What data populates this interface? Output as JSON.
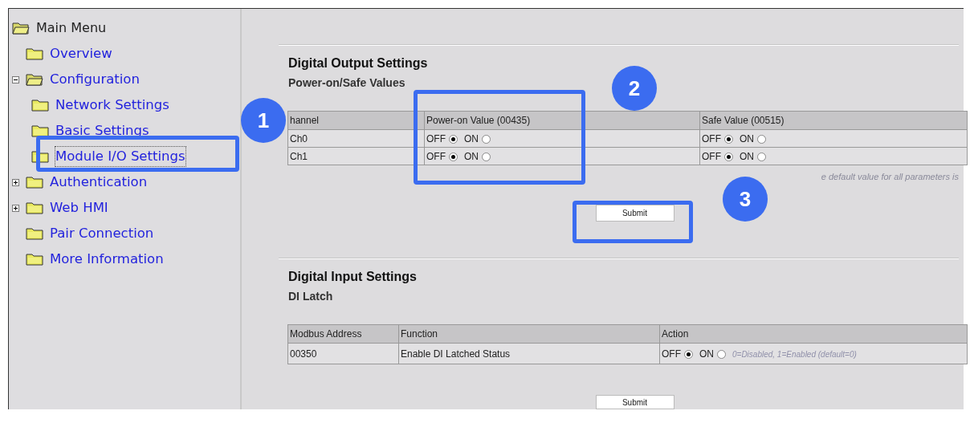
{
  "sidebar": {
    "root": {
      "label": "Main Menu",
      "expanded": true
    },
    "items": [
      {
        "label": "Overview",
        "selected": false
      },
      {
        "label": "Configuration",
        "selected": false,
        "expanded": true,
        "children": [
          {
            "label": "Network Settings",
            "selected": false
          },
          {
            "label": "Basic Settings",
            "selected": false
          },
          {
            "label": "Module I/O Settings",
            "selected": true
          }
        ]
      },
      {
        "label": "Authentication",
        "selected": false,
        "expanded": false
      },
      {
        "label": "Web HMI",
        "selected": false,
        "expanded": false
      },
      {
        "label": "Pair Connection",
        "selected": false
      },
      {
        "label": "More Information",
        "selected": false
      }
    ]
  },
  "output_section": {
    "title": "Digital Output Settings",
    "subtitle": "Power-on/Safe Values",
    "columns": [
      "hannel",
      "Power-on Value (00435)",
      "Safe Value (00515)"
    ],
    "rows": [
      {
        "channel": "Ch0",
        "power_on": [
          {
            "label": "OFF",
            "selected": true
          },
          {
            "label": "ON",
            "selected": false
          }
        ],
        "safe": [
          {
            "label": "OFF",
            "selected": true
          },
          {
            "label": "ON",
            "selected": false
          }
        ]
      },
      {
        "channel": "Ch1",
        "power_on": [
          {
            "label": "OFF",
            "selected": true
          },
          {
            "label": "ON",
            "selected": false
          }
        ],
        "safe": [
          {
            "label": "OFF",
            "selected": true
          },
          {
            "label": "ON",
            "selected": false
          }
        ]
      }
    ],
    "note": "e default value for all parameters is",
    "submit": "Submit"
  },
  "input_section": {
    "title": "Digital Input Settings",
    "subtitle": "DI Latch",
    "columns": [
      "Modbus Address",
      "Function",
      "Action"
    ],
    "rows": [
      {
        "address": "00350",
        "function": "Enable DI Latched Status",
        "action": [
          {
            "label": "OFF",
            "selected": true
          },
          {
            "label": "ON",
            "selected": false
          }
        ],
        "hint": "0=Disabled, 1=Enabled (default=0)"
      }
    ],
    "submit": "Submit"
  },
  "callouts": [
    {
      "number": "1"
    },
    {
      "number": "2"
    },
    {
      "number": "3"
    }
  ]
}
